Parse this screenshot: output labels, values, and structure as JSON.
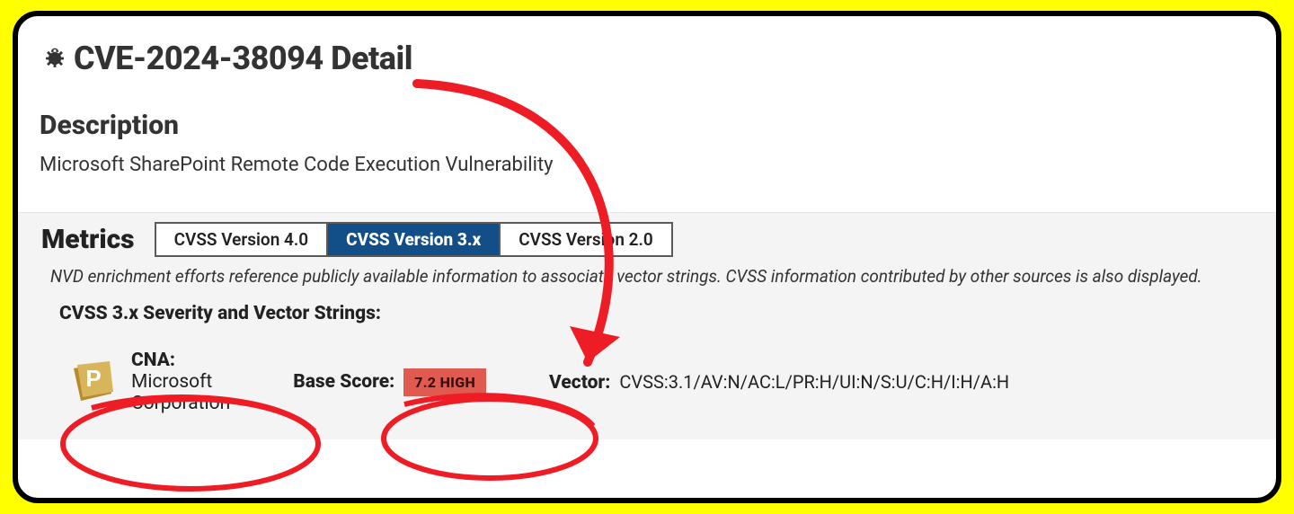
{
  "title": "CVE-2024-38094 Detail",
  "description_heading": "Description",
  "description_text": "Microsoft SharePoint Remote Code Execution Vulnerability",
  "metrics": {
    "heading": "Metrics",
    "tabs": [
      {
        "label": "CVSS Version 4.0",
        "active": false
      },
      {
        "label": "CVSS Version 3.x",
        "active": true
      },
      {
        "label": "CVSS Version 2.0",
        "active": false
      }
    ],
    "nvd_note": "NVD enrichment efforts reference publicly available information to associate vector strings. CVSS information contributed by other sources is also displayed.",
    "severity_heading": "CVSS 3.x Severity and Vector Strings:",
    "cna_label": "CNA:",
    "cna_value": "Microsoft Corporation",
    "base_label": "Base Score:",
    "base_value": "7.2 HIGH",
    "vector_label": "Vector:",
    "vector_value": "CVSS:3.1/AV:N/AC:L/PR:H/UI:N/S:U/C:H/I:H/A:H",
    "badge_letter": "P"
  },
  "colors": {
    "accent": "#124e87",
    "high": "#e05a50",
    "highlight": "#ffff00",
    "annotation": "#ee1c25"
  }
}
